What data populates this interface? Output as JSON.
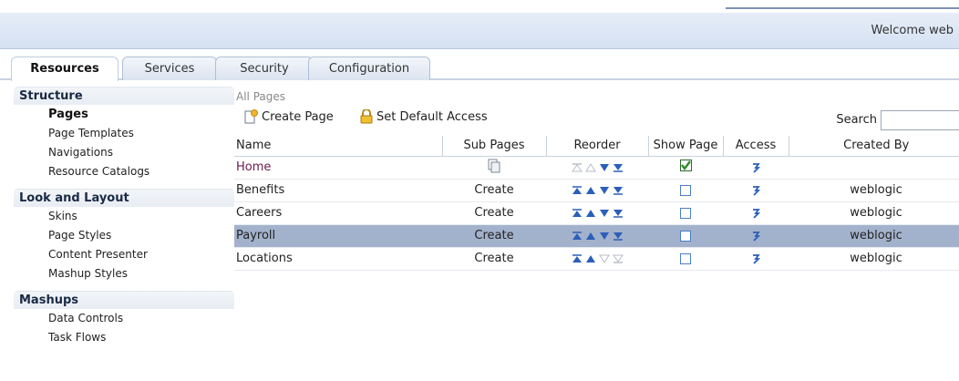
{
  "header": {
    "welcome": "Welcome web"
  },
  "tabs": [
    {
      "label": "Resources",
      "active": true
    },
    {
      "label": "Services",
      "active": false
    },
    {
      "label": "Security",
      "active": false
    },
    {
      "label": "Configuration",
      "active": false
    }
  ],
  "sidebar": {
    "groups": [
      {
        "title": "Structure",
        "items": [
          "Pages",
          "Page Templates",
          "Navigations",
          "Resource Catalogs"
        ]
      },
      {
        "title": "Look and Layout",
        "items": [
          "Skins",
          "Page Styles",
          "Content Presenter",
          "Mashup Styles"
        ]
      },
      {
        "title": "Mashups",
        "items": [
          "Data Controls",
          "Task Flows"
        ]
      }
    ],
    "selected": "Pages"
  },
  "main": {
    "breadcrumb": "All Pages",
    "toolbar": {
      "create_page": "Create Page",
      "set_default_access": "Set Default Access",
      "search_label": "Search",
      "search_value": ""
    },
    "columns": [
      "Name",
      "Sub Pages",
      "Reorder",
      "Show Page",
      "Access",
      "Created By"
    ],
    "rows": [
      {
        "name": "Home",
        "sub_pages": "",
        "show_page": true,
        "created_by": ""
      },
      {
        "name": "Benefits",
        "sub_pages": "Create",
        "show_page": false,
        "created_by": "weblogic"
      },
      {
        "name": "Careers",
        "sub_pages": "Create",
        "show_page": false,
        "created_by": "weblogic"
      },
      {
        "name": "Payroll",
        "sub_pages": "Create",
        "show_page": false,
        "created_by": "weblogic",
        "selected": true
      },
      {
        "name": "Locations",
        "sub_pages": "Create",
        "show_page": false,
        "created_by": "weblogic"
      }
    ]
  },
  "colors": {
    "selected_row": "#a3b2cc",
    "link": "#6b1a4e",
    "arrow_active": "#2b5fb8",
    "arrow_disabled": "#b8bec8"
  }
}
